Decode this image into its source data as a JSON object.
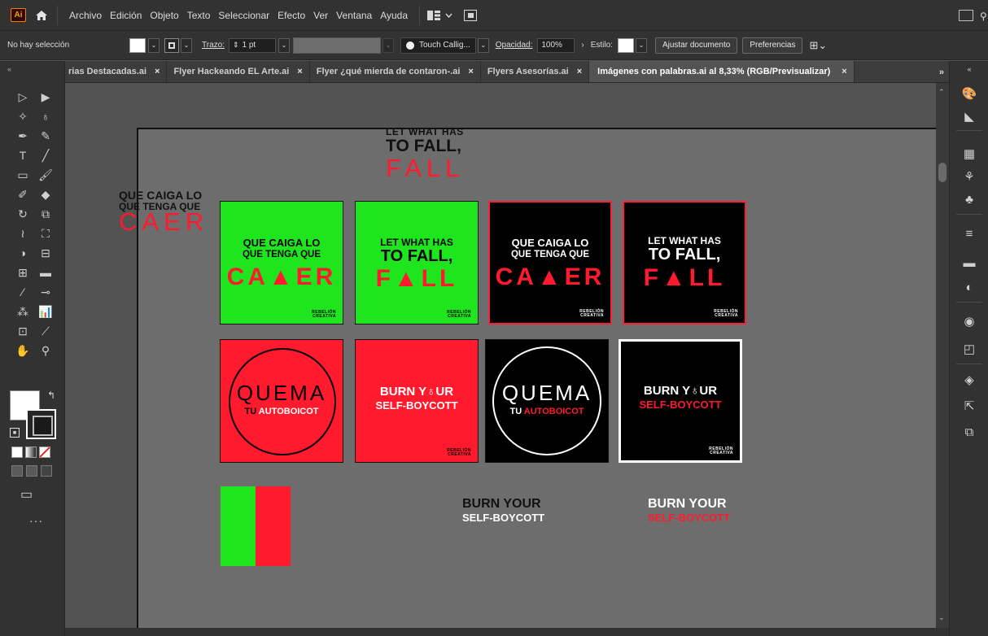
{
  "menubar": {
    "logo": "Ai",
    "items": [
      "Archivo",
      "Edición",
      "Objeto",
      "Texto",
      "Seleccionar",
      "Efecto",
      "Ver",
      "Ventana",
      "Ayuda"
    ]
  },
  "controlbar": {
    "selection": "No hay selección",
    "stroke_label": "Trazo:",
    "stroke_value": "1 pt",
    "brush": "Touch Callig...",
    "opacity_label": "Opacidad:",
    "opacity_value": "100%",
    "style_label": "Estilo:",
    "fit_button": "Ajustar documento",
    "prefs_button": "Preferencias"
  },
  "tabs": [
    {
      "label": "rias Destacadas.ai",
      "active": false
    },
    {
      "label": "Flyer Hackeando EL Arte.ai",
      "active": false
    },
    {
      "label": "Flyer ¿qué mierda de contaron-.ai",
      "active": false
    },
    {
      "label": "Flyers Asesorías.ai",
      "active": false
    },
    {
      "label": "Imágenes con palabras.ai al 8,33% (RGB/Previsualizar)",
      "active": true
    }
  ],
  "tab_close": "×",
  "tabs_more": "»",
  "artwork": {
    "top_fall": {
      "line1": "LET WHAT HAS",
      "line2": "TO FALL,",
      "line3": "FALL"
    },
    "top_caer": {
      "line1": "QUE CAIGA LO",
      "line2": "QUE TENGA QUE",
      "line3": "CAER"
    },
    "card1": {
      "line1": "QUE CAIGA LO",
      "line2": "QUE TENGA QUE",
      "big": "CA▲ER"
    },
    "card2": {
      "line1": "LET WHAT HAS",
      "line2": "TO FALL,",
      "big": "F▲LL"
    },
    "card3": {
      "line1": "QUE CAIGA LO",
      "line2": "QUE TENGA QUE",
      "big": "CA▲ER"
    },
    "card4": {
      "line1": "LET WHAT HAS",
      "line2": "TO FALL,",
      "big": "F▲LL"
    },
    "card5": {
      "line1": "QUEMA",
      "line2a": "TU ",
      "line2b": "AUTOBOICOT"
    },
    "card6": {
      "line1": "BURN Y♁UR",
      "line2": "SELF-BOYCOTT"
    },
    "card7": {
      "line1": "QUEMA",
      "line2a": "TU ",
      "line2b": "AUTOBOICOT"
    },
    "card8": {
      "line1": "BURN Y♁UR",
      "line2": "SELF-BOYCOTT"
    },
    "brand_line1": "REBELIÓN",
    "brand_line2": "CREATIVA",
    "bottom_text1": {
      "line1": "BURN YOUR",
      "line2": "SELF-BOYCOTT"
    },
    "bottom_text2": {
      "line1": "BURN YOUR",
      "line2": "SELF-BOYCOTT"
    }
  },
  "colors": {
    "green": "#1ee51e",
    "red": "#ff1a2e",
    "black": "#000000",
    "white": "#ffffff"
  },
  "more_tools": "···"
}
